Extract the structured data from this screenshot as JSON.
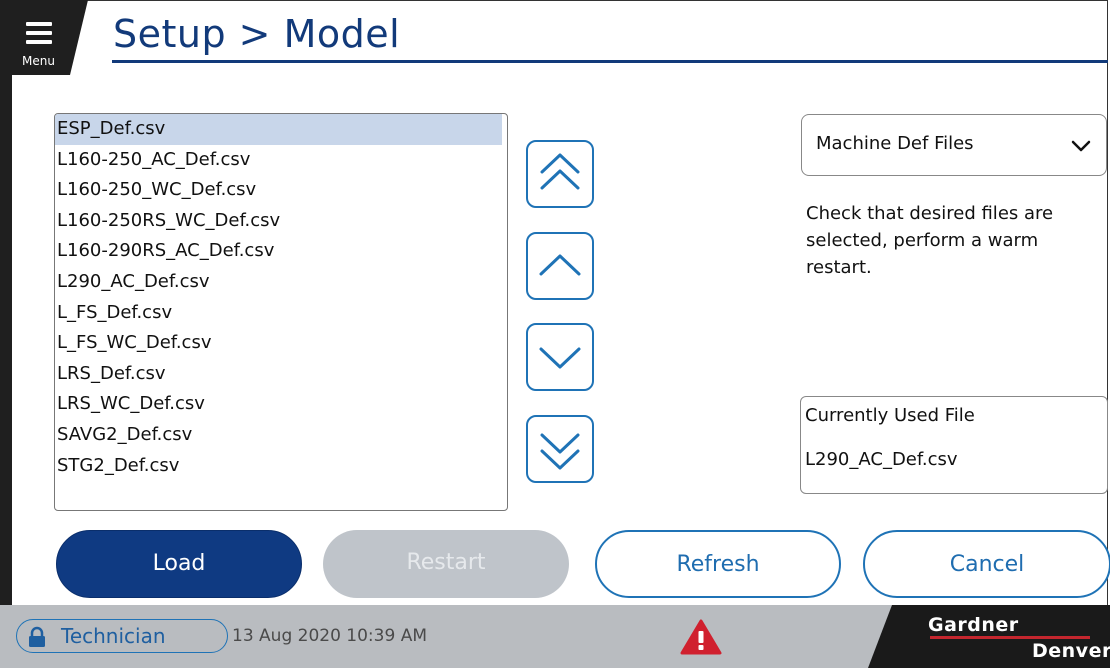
{
  "header": {
    "menu_label": "Menu",
    "title": "Setup > Model"
  },
  "file_list": {
    "selected_index": 0,
    "items": [
      "ESP_Def.csv",
      "L160-250_AC_Def.csv",
      "L160-250_WC_Def.csv",
      "L160-250RS_WC_Def.csv",
      "L160-290RS_AC_Def.csv",
      "L290_AC_Def.csv",
      "L_FS_Def.csv",
      "L_FS_WC_Def.csv",
      "LRS_Def.csv",
      "LRS_WC_Def.csv",
      "SAVG2_Def.csv",
      "STG2_Def.csv"
    ]
  },
  "scroll_buttons": [
    "page-up-icon",
    "up-icon",
    "down-icon",
    "page-down-icon"
  ],
  "right_panel": {
    "dropdown_value": "Machine Def Files",
    "instructions": "Check that desired files are selected, perform a warm restart.",
    "current_file_label": "Currently Used File",
    "current_file_value": "L290_AC_Def.csv"
  },
  "actions": {
    "load": "Load",
    "restart": "Restart",
    "refresh": "Refresh",
    "cancel": "Cancel"
  },
  "status_bar": {
    "user_level": "Technician",
    "datetime": "13 Aug 2020  10:39 AM",
    "brand_line1": "Gardner",
    "brand_line2": "Denver"
  },
  "colors": {
    "brand_blue": "#123a7a",
    "accent_blue": "#1f73b6",
    "alarm_red": "#d0202e",
    "status_gray": "#b9bcc0"
  }
}
